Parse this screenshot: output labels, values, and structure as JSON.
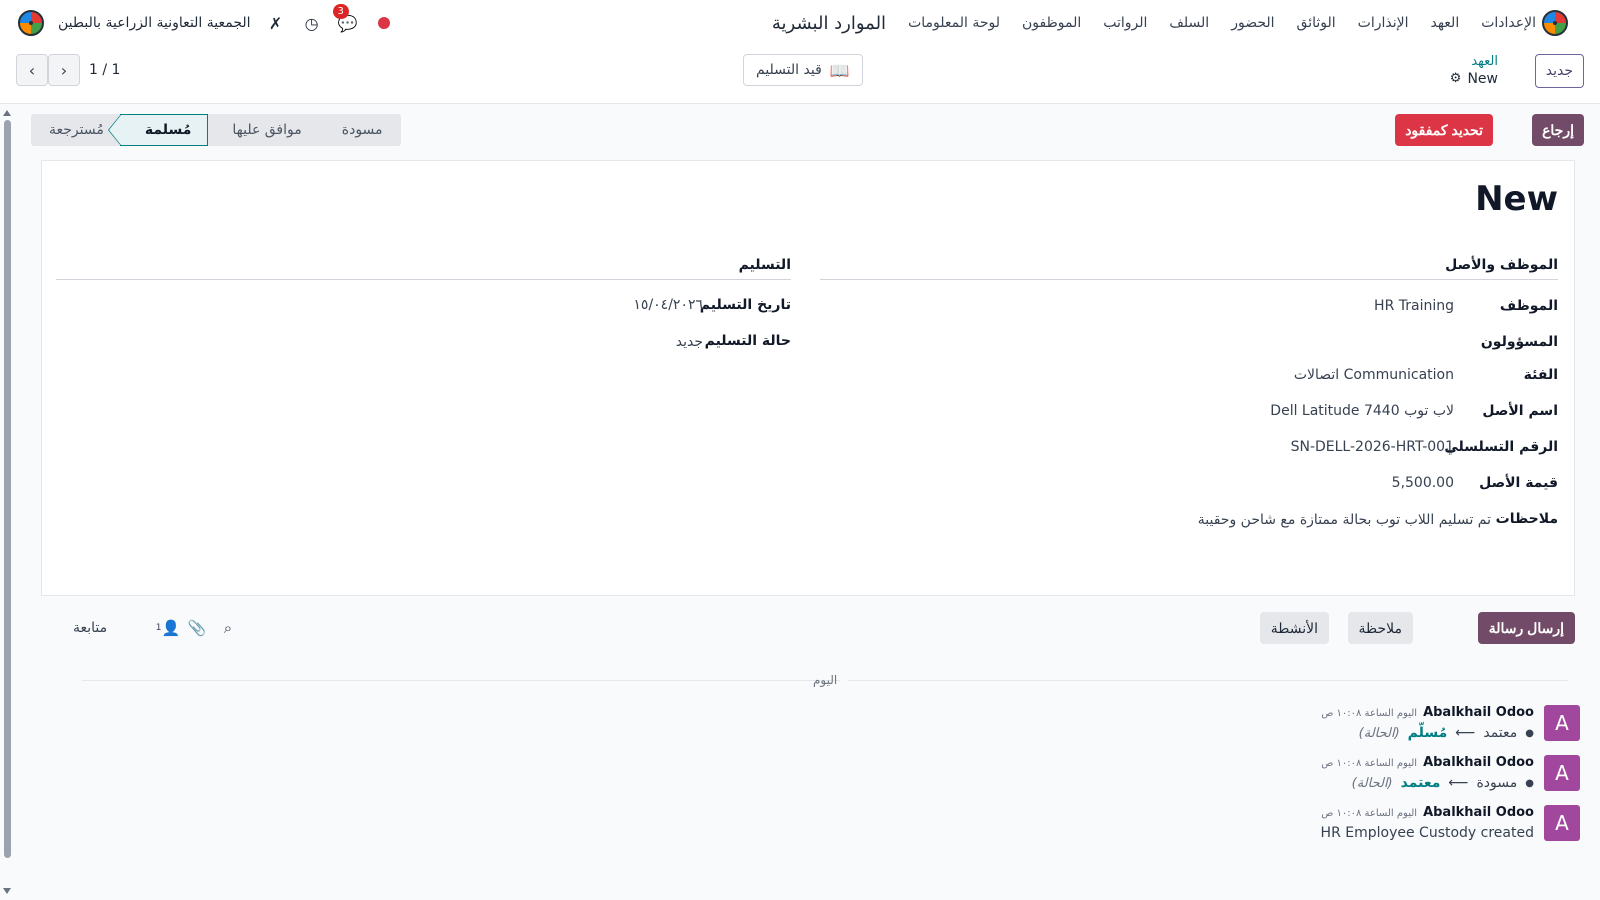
{
  "navbar": {
    "brand": "الموارد البشرية",
    "menu": [
      "لوحة المعلومات",
      "الموظفون",
      "الرواتب",
      "السلف",
      "الحضور",
      "الوثائق",
      "الإنذارات",
      "العهد",
      "الإعدادات"
    ],
    "company": "الجمعية التعاونية الزراعية بالبطين",
    "chat_badge": "3"
  },
  "control": {
    "new_button": "جديد",
    "breadcrumb_parent": "العهد",
    "breadcrumb_current": "New",
    "handover_button": "قيد التسليم",
    "pager": "1 / 1"
  },
  "actions": {
    "return": "إرجاع",
    "mark_lost": "تحديد كمفقود"
  },
  "status_stages": [
    {
      "label": "مُسترجعة",
      "active": false
    },
    {
      "label": "مُسلمة",
      "active": true
    },
    {
      "label": "موافق عليها",
      "active": false
    },
    {
      "label": "مسودة",
      "active": false
    }
  ],
  "form": {
    "title": "New",
    "group_employee": {
      "title": "الموظف والأصل",
      "fields": [
        {
          "label": "الموظف",
          "value": "HR Training"
        },
        {
          "label": "المسؤولون",
          "value": ""
        },
        {
          "label": "الفئة",
          "value": "Communication اتصالات"
        },
        {
          "label": "اسم الأصل",
          "value": "لاب توب Dell Latitude 7440"
        },
        {
          "label": "الرقم التسلسلي",
          "value": "SN-DELL-2026-HRT-001"
        },
        {
          "label": "قيمة الأصل",
          "value": "5,500.00"
        },
        {
          "label": "ملاحظات",
          "value": "تم تسليم اللاب توب بحالة ممتازة مع شاحن وحقيبة"
        }
      ]
    },
    "group_delivery": {
      "title": "التسليم",
      "fields": [
        {
          "label": "تاريخ التسليم",
          "value": "١٥/٠٤/٢٠٢٦"
        },
        {
          "label": "حالة التسليم",
          "value": "جديد"
        }
      ]
    }
  },
  "chatter": {
    "send_message": "إرسال رسالة",
    "log_note": "ملاحظة",
    "activities": "الأنشطة",
    "follow": "متابعة",
    "followers_count": "1",
    "today": "اليوم",
    "messages": [
      {
        "avatar": "A",
        "author": "Abalkhail Odoo",
        "time": "اليوم الساعة ١٠:٠٨ ص",
        "old": "معتمد",
        "new": "مُسلّم",
        "field": "(الحالة)"
      },
      {
        "avatar": "A",
        "author": "Abalkhail Odoo",
        "time": "اليوم الساعة ١٠:٠٨ ص",
        "old": "مسودة",
        "new": "معتمد",
        "field": "(الحالة)"
      },
      {
        "avatar": "A",
        "author": "Abalkhail Odoo",
        "time": "اليوم الساعة ١٠:٠٨ ص",
        "text": "HR Employee Custody created"
      }
    ]
  },
  "colors": {
    "primary": "#714b67",
    "danger": "#dc3545",
    "teal": "#017e84",
    "avatar": "#a2479e"
  }
}
